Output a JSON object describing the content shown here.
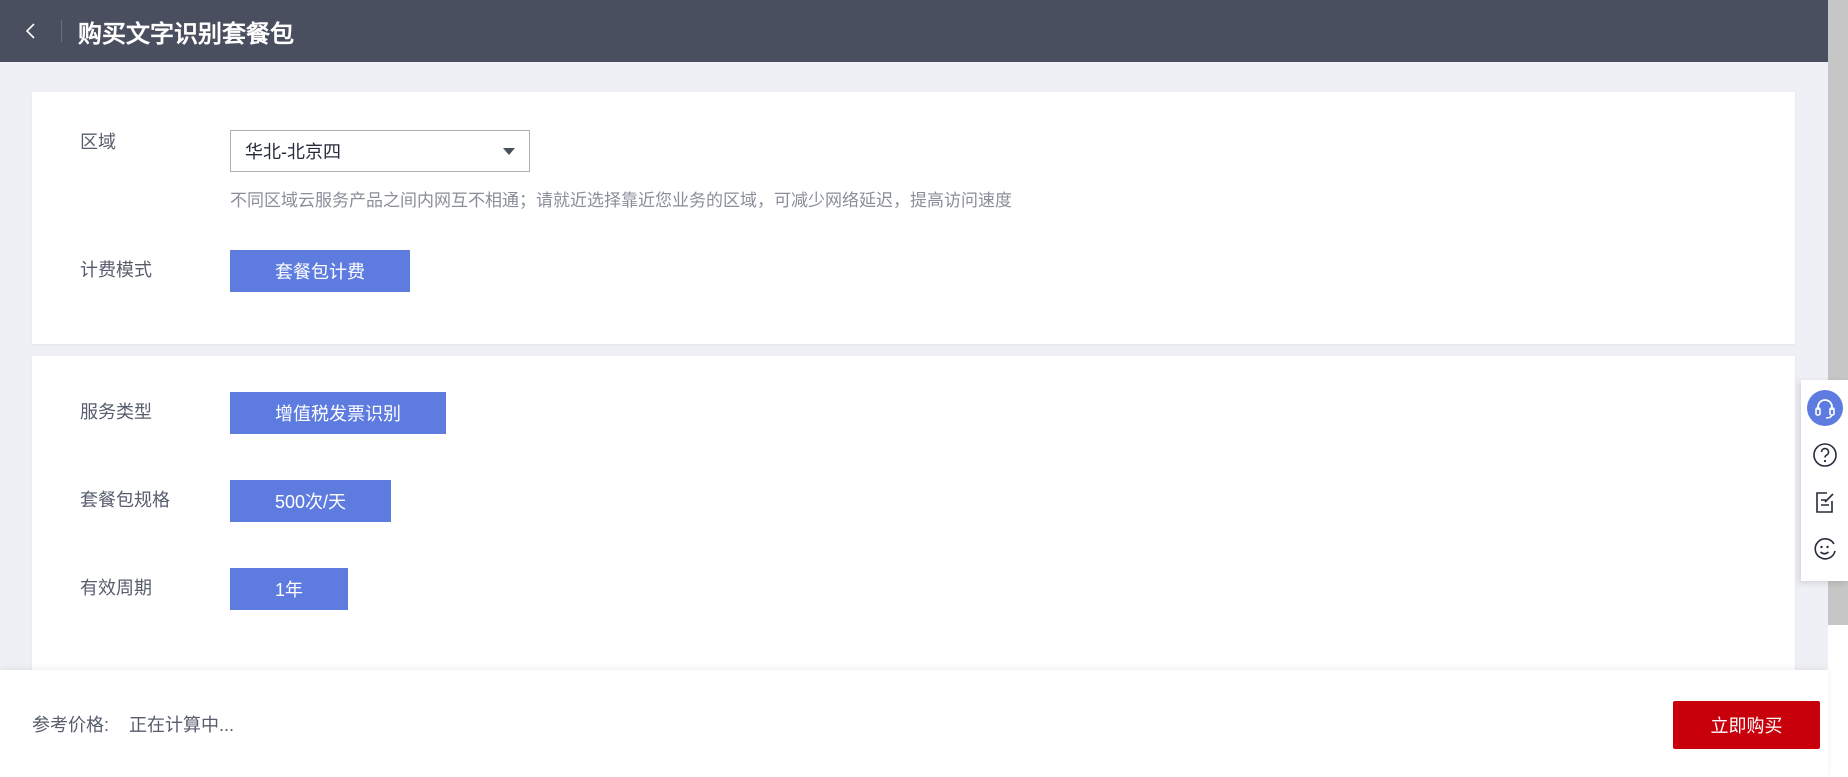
{
  "header": {
    "title": "购买文字识别套餐包",
    "back_icon": "chevron-left-icon"
  },
  "region": {
    "label": "区域",
    "selected": "华北-北京四",
    "hint": "不同区域云服务产品之间内网互不相通；请就近选择靠近您业务的区域，可减少网络延迟，提高访问速度"
  },
  "billing": {
    "label": "计费模式",
    "option": "套餐包计费"
  },
  "service_type": {
    "label": "服务类型",
    "option": "增值税发票识别"
  },
  "package_spec": {
    "label": "套餐包规格",
    "option": "500次/天"
  },
  "period": {
    "label": "有效周期",
    "option": "1年"
  },
  "footer": {
    "price_label": "参考价格:",
    "price_value": "正在计算中...",
    "buy_label": "立即购买"
  },
  "side_tools": [
    "headset-icon",
    "help-icon",
    "feedback-icon",
    "smile-icon"
  ],
  "colors": {
    "header_bg": "#4a4f5f",
    "accent": "#5e7ce0",
    "buy": "#c7000b"
  }
}
